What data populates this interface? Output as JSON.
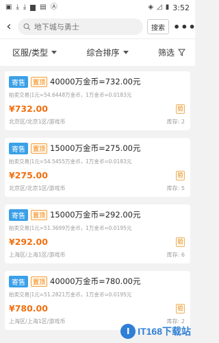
{
  "status_bar": {
    "time": "3:52",
    "left_icons": [
      "gamepad-icon",
      "download-icon",
      "download-icon",
      "book-icon",
      "file-icon",
      "font-icon"
    ],
    "right_icons": [
      "wifi-icon",
      "signal-off-icon",
      "battery-icon"
    ]
  },
  "header": {
    "search_placeholder": "地下城与勇士",
    "search_button": "搜索",
    "more_label": "•••"
  },
  "filters": {
    "region": "区服/类型",
    "sort": "综合排序",
    "filter": "筛选"
  },
  "listings": [
    {
      "sell_tag": "寄售",
      "top_tag": "置顶",
      "title": "40000万金币=732.00元",
      "subtitle": "拍卖交易|1元=54.6448万金币，1万金币=0.0183元",
      "price": "¥732.00",
      "check_tag": "验",
      "region": "北京区/北京1区/游戏币",
      "stock": "库存: 2"
    },
    {
      "sell_tag": "寄售",
      "top_tag": "置顶",
      "title": "15000万金币=275.00元",
      "subtitle": "拍卖交易|1元=54.5455万金币，1万金币=0.0183元",
      "price": "¥275.00",
      "check_tag": "验",
      "region": "北京区/北京1区/游戏币",
      "stock": "库存: 5"
    },
    {
      "sell_tag": "寄售",
      "top_tag": "置顶",
      "title": "15000万金币=292.00元",
      "subtitle": "拍卖交易|1元=51.3699万金币，1万金币=0.0195元",
      "price": "¥292.00",
      "check_tag": "验",
      "region": "上海区/上海1区/游戏币",
      "stock": "库存: 6"
    },
    {
      "sell_tag": "寄售",
      "top_tag": "置顶",
      "title": "40000万金币=780.00元",
      "subtitle": "拍卖交易|1元=51.2821万金币，1万金币=0.0195元",
      "price": "¥780.00",
      "check_tag": "验",
      "region": "上海区/上海1区/游戏币",
      "stock": "库存: 2"
    }
  ],
  "watermark": {
    "logo_text": "I",
    "text": "IT168下载站"
  },
  "colors": {
    "accent_blue": "#3aa0e8",
    "price_orange": "#f07010",
    "top_tag_orange": "#f08000"
  }
}
